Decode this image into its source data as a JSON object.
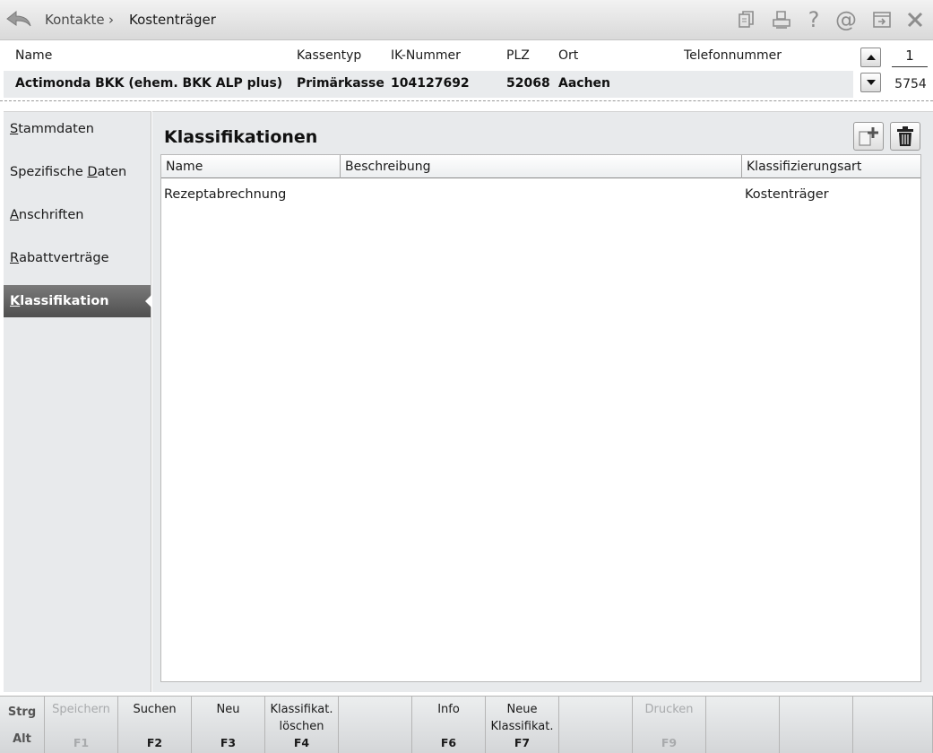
{
  "breadcrumb": {
    "parent": "Kontakte",
    "separator": "›",
    "current": "Kostenträger"
  },
  "toolbar": {
    "help_label": "?",
    "email_label": "@"
  },
  "header": {
    "columns": {
      "name": "Name",
      "kassentyp": "Kassentyp",
      "ik": "IK-Nummer",
      "plz": "PLZ",
      "ort": "Ort",
      "telefon": "Telefonnummer"
    },
    "record": {
      "name": "Actimonda BKK (ehem. BKK ALP plus)",
      "kassentyp": "Primärkasse",
      "ik": "104127692",
      "plz": "52068",
      "ort": "Aachen",
      "telefon": ""
    },
    "pager": {
      "current": "1",
      "total": "5754"
    }
  },
  "sidebar": {
    "items": [
      {
        "underline": "S",
        "rest": "tammdaten"
      },
      {
        "pre": "Spezifische ",
        "underline": "D",
        "rest": "aten"
      },
      {
        "underline": "A",
        "rest": "nschriften"
      },
      {
        "underline": "R",
        "rest": "abattverträge"
      },
      {
        "underline": "K",
        "rest": "lassifikation"
      }
    ]
  },
  "main": {
    "title": "Klassifikationen",
    "table": {
      "headers": [
        "Name",
        "Beschreibung",
        "Klassifizierungsart"
      ],
      "rows": [
        [
          "Rezeptabrechnung",
          "",
          "Kostenträger"
        ]
      ]
    }
  },
  "fkeys": {
    "modifiers": {
      "strg": "Strg",
      "alt": "Alt"
    },
    "keys": [
      {
        "label": "Speichern",
        "key": "F1",
        "enabled": false
      },
      {
        "label": "Suchen",
        "key": "F2",
        "enabled": true
      },
      {
        "label": "Neu",
        "key": "F3",
        "enabled": true
      },
      {
        "label": "Klassifikat.\nlöschen",
        "key": "F4",
        "enabled": true
      },
      {
        "label": "",
        "key": "",
        "enabled": false
      },
      {
        "label": "Info",
        "key": "F6",
        "enabled": true
      },
      {
        "label": "Neue\nKlassifikat.",
        "key": "F7",
        "enabled": true
      },
      {
        "label": "",
        "key": "",
        "enabled": false
      },
      {
        "label": "Drucken",
        "key": "F9",
        "enabled": false
      },
      {
        "label": "",
        "key": "",
        "enabled": false
      },
      {
        "label": "",
        "key": "",
        "enabled": false
      },
      {
        "label": "",
        "key": "",
        "enabled": false
      }
    ]
  }
}
